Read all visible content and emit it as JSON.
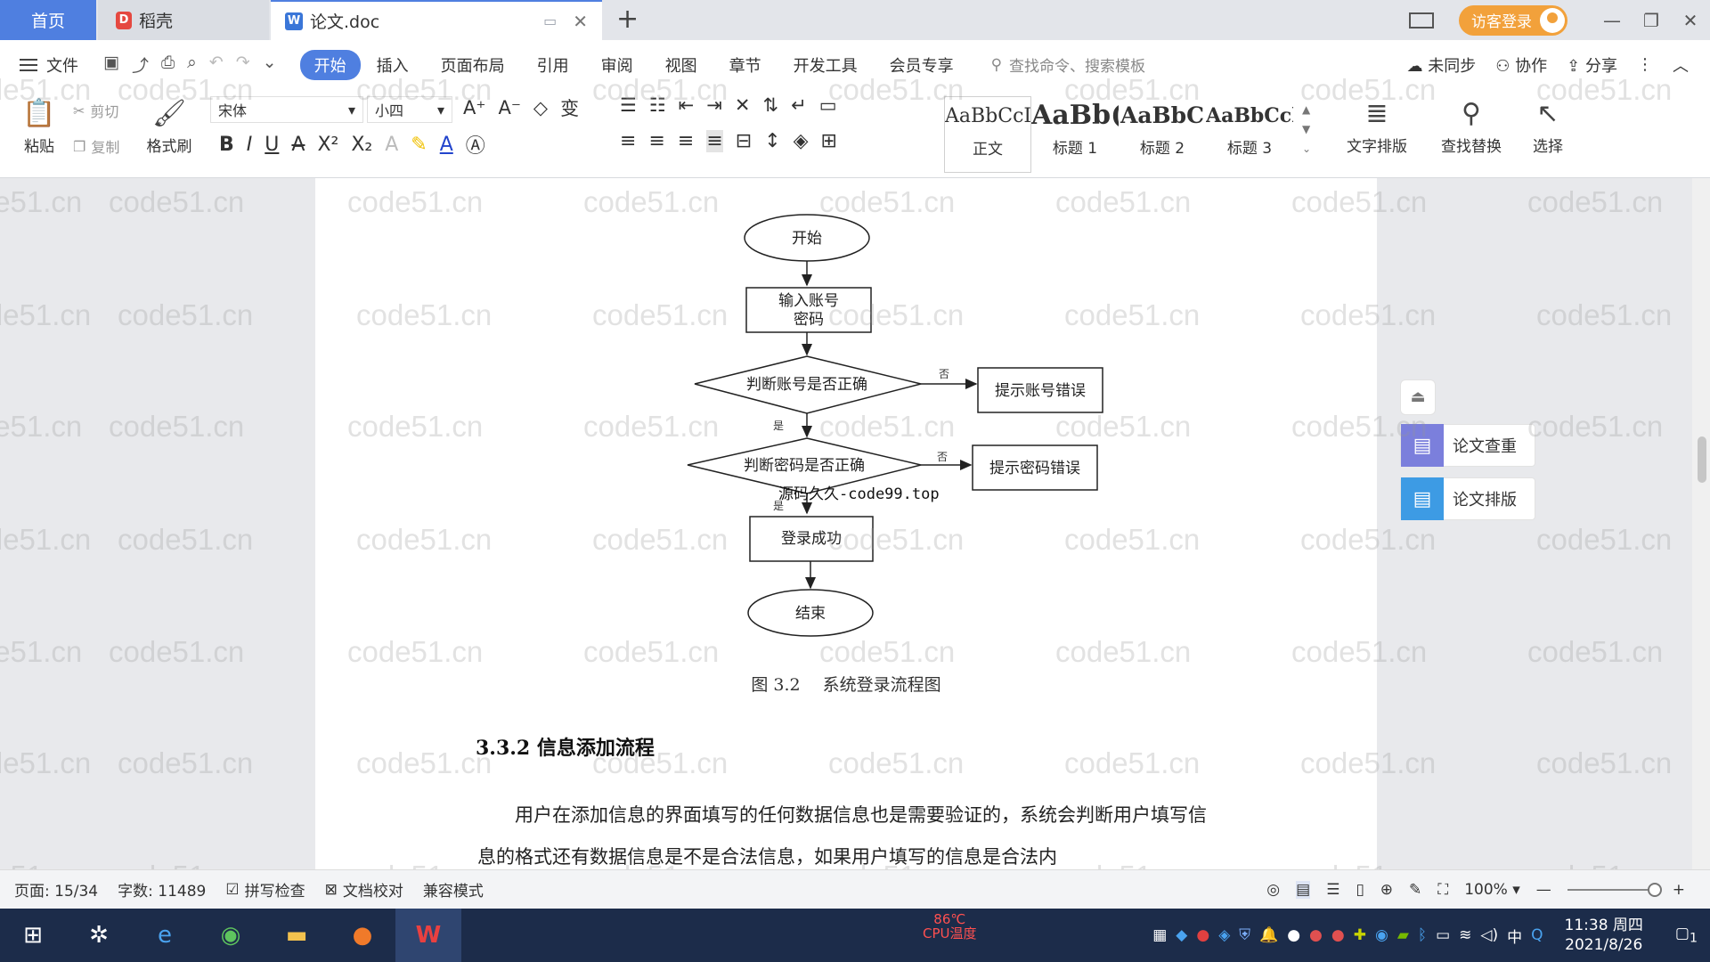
{
  "tabs": {
    "home": "首页",
    "daoke": "稻壳",
    "doc": "论文.doc"
  },
  "window": {
    "visitor_login": "访客登录"
  },
  "menu": {
    "file": "文件",
    "tabs": [
      "开始",
      "插入",
      "页面布局",
      "引用",
      "审阅",
      "视图",
      "章节",
      "开发工具",
      "会员专享"
    ],
    "search_placeholder": "查找命令、搜索模板",
    "sync": "未同步",
    "collab": "协作",
    "share": "分享"
  },
  "toolbar": {
    "paste": "粘贴",
    "cut": "剪切",
    "copy": "复制",
    "format_painter": "格式刷",
    "font_name": "宋体",
    "font_size": "小四",
    "styles": [
      {
        "preview": "AaBbCcI",
        "name": "正文"
      },
      {
        "preview": "AaBb(",
        "name": "标题 1"
      },
      {
        "preview": "AaBbC",
        "name": "标题 2"
      },
      {
        "preview": "AaBbCcl",
        "name": "标题 3"
      }
    ],
    "text_layout": "文字排版",
    "find_replace": "查找替换",
    "select": "选择"
  },
  "flowchart": {
    "start": "开始",
    "input_line1": "输入账号",
    "input_line2": "密码",
    "check_account": "判断账号是否正确",
    "account_error": "提示账号错误",
    "check_password": "判断密码是否正确",
    "password_error": "提示密码错误",
    "success": "登录成功",
    "end": "结束",
    "yes": "是",
    "no": "否"
  },
  "document": {
    "figure_caption": "图 3.2　 系统登录流程图",
    "heading": "3.3.2 信息添加流程",
    "paragraph": "用户在添加信息的界面填写的任何数据信息也是需要验证的，系统会判断用户填写信息的格式还有数据信息是不是合法信息，如果用户填写的信息是合法内",
    "overlay_text": "源码久久-code99.top"
  },
  "watermark": "code51.cn",
  "sidepanel": {
    "check": "论文查重",
    "layout": "论文排版"
  },
  "status": {
    "page": "页面: 15/34",
    "words": "字数: 11489",
    "spell": "拼写检查",
    "proof": "文档校对",
    "compat": "兼容模式",
    "zoom": "100%"
  },
  "taskbar": {
    "cpu_temp": "86℃",
    "cpu_label": "CPU温度",
    "ime": "中",
    "time": "11:38 周四",
    "date": "2021/8/26",
    "notify_count": "1"
  },
  "colors": {
    "accent": "#4f7fe0",
    "visitor": "#f2a13b",
    "taskbar": "#1c2c4a"
  }
}
